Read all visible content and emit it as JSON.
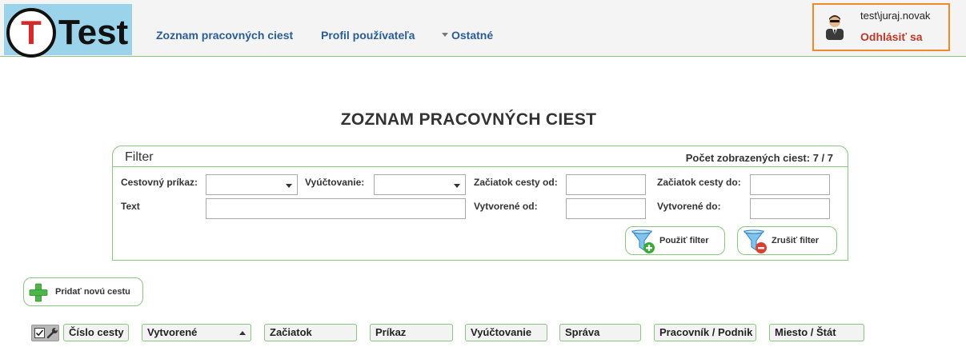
{
  "header": {
    "logo_letter": "T",
    "logo_text": "Test",
    "nav": {
      "trips": "Zoznam pracovných ciest",
      "profile": "Profil používateľa",
      "other": "Ostatné"
    },
    "user": {
      "name": "test\\juraj.novak",
      "logout": "Odhlásiť sa"
    }
  },
  "page": {
    "title": "ZOZNAM PRACOVNÝCH CIEST"
  },
  "filter": {
    "title": "Filter",
    "count": "Počet zobrazených ciest: 7 / 7",
    "labels": {
      "travel_order": "Cestovný príkaz:",
      "settlement": "Vyúčtovanie:",
      "trip_start_from": "Začiatok cesty od:",
      "trip_start_to": "Začiatok cesty do:",
      "text": "Text",
      "created_from": "Vytvorené od:",
      "created_to": "Vytvorené do:"
    },
    "values": {
      "travel_order": "",
      "settlement": "",
      "trip_start_from": "",
      "trip_start_to": "",
      "text": "",
      "created_from": "",
      "created_to": ""
    },
    "apply": "Použiť filter",
    "reset": "Zrušiť filter"
  },
  "actions": {
    "add_trip": "Pridať novú cestu"
  },
  "table": {
    "columns": [
      "Číslo cesty",
      "Vytvorené",
      "Začiatok",
      "Príkaz",
      "Vyúčtovanie",
      "Správa",
      "Pracovník / Podnik",
      "Miesto / Štát"
    ],
    "sorted_column": "Vytvorené",
    "sort_direction": "ascending"
  },
  "colors": {
    "accent_green": "#8cc483",
    "nav_blue": "#2a5d93",
    "logout_red": "#b83a2a",
    "user_box_orange": "#ef8a2a",
    "logo_bg": "#9ad3ea"
  }
}
